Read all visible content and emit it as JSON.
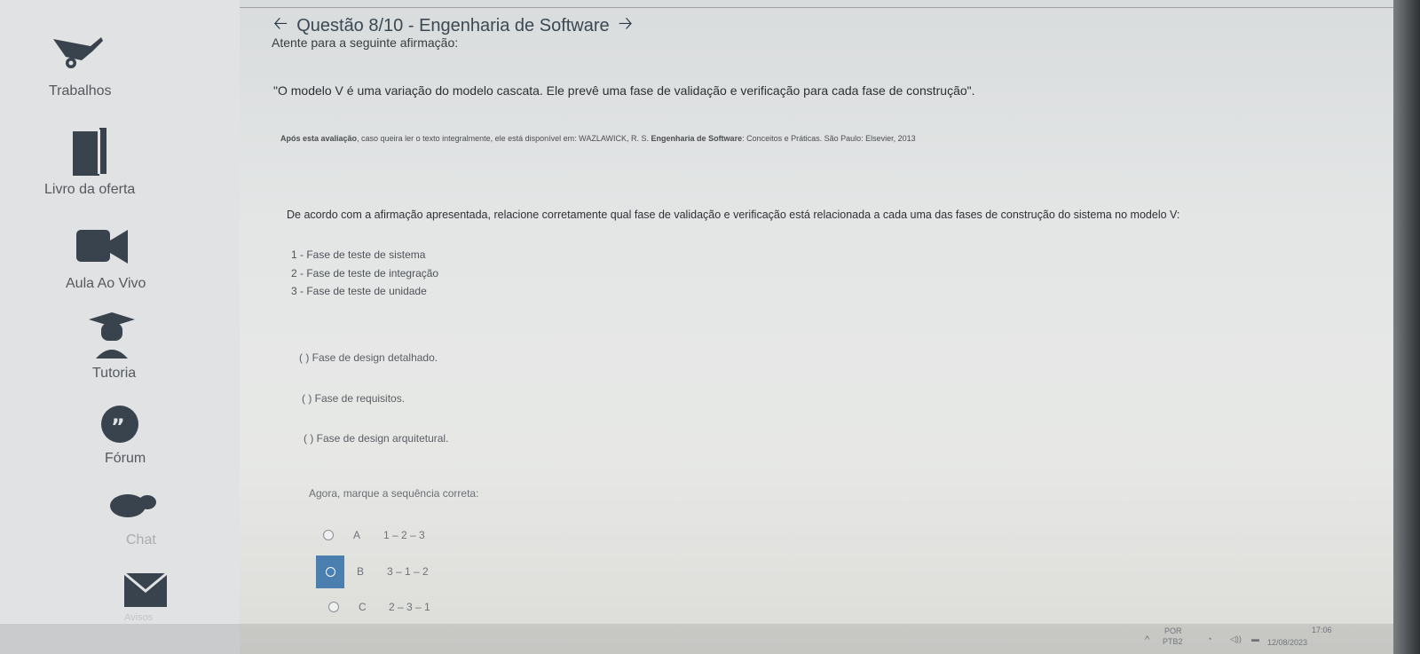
{
  "header": {
    "title": "Questão 8/10 - Engenharia de Software"
  },
  "sidebar": {
    "items": [
      {
        "label": "Trabalhos"
      },
      {
        "label": "Livro da oferta"
      },
      {
        "label": "Aula Ao Vivo"
      },
      {
        "label": "Tutoria"
      },
      {
        "label": "Fórum"
      },
      {
        "label": "Chat"
      },
      {
        "label": "Avisos"
      }
    ]
  },
  "question": {
    "intro": "Atente para a seguinte afirmação:",
    "statement": "\"O modelo V é uma variação do modelo cascata. Ele prevê uma fase de validação e verificação para cada fase de construção\".",
    "reference_bold1": "Após esta avaliação",
    "reference_mid": ", caso queira ler o texto integralmente, ele está disponível em: WAZLAWICK, R. S.",
    "reference_bold2": "Engenharia de Software",
    "reference_end": ": Conceitos e Práticas. São Paulo: Elsevier, 2013",
    "prompt": "De acordo com a afirmação apresentada, relacione corretamente qual fase de validação e verificação está relacionada a cada uma das fases de construção do sistema no modelo V:",
    "phases": [
      "1 - Fase de teste de sistema",
      "2 - Fase de teste de integração",
      "3 - Fase de teste de unidade"
    ],
    "blanks": [
      "( ) Fase de design detalhado.",
      "( ) Fase de requisitos.",
      "( ) Fase de design arquitetural."
    ],
    "instruction": "Agora, marque a sequência correta:",
    "options": [
      {
        "letter": "A",
        "value": "1 – 2 – 3",
        "selected": false
      },
      {
        "letter": "B",
        "value": "3 – 1 – 2",
        "selected": true
      },
      {
        "letter": "C",
        "value": "2 – 3 – 1",
        "selected": false
      }
    ]
  },
  "taskbar": {
    "lang1": "POR",
    "lang2": "PTB2",
    "time": "17:06",
    "date": "12/08/2023"
  },
  "colors": {
    "accent": "#4a7fb0",
    "icon": "#39434d"
  }
}
